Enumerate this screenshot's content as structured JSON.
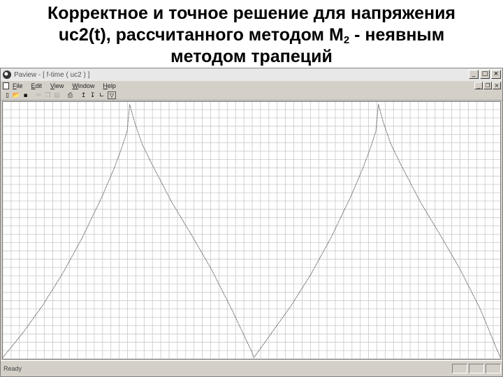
{
  "slide": {
    "title_line1": "Корректное и точное решение для напряжения",
    "title_line2_prefix": "uc2(t), рассчитанного методом M",
    "title_line2_sub": "2",
    "title_line2_suffix": " - неявным",
    "title_line3": "методом трапеций"
  },
  "window": {
    "title": "Paview - [ f-time ( uc2 ) ]",
    "minimize_label": "_",
    "maximize_label": "□",
    "close_label": "×"
  },
  "menu": {
    "items": [
      {
        "label": "File"
      },
      {
        "label": "Edit"
      },
      {
        "label": "View"
      },
      {
        "label": "Window"
      },
      {
        "label": "Help"
      }
    ],
    "mdi_minimize": "_",
    "mdi_restore": "❐",
    "mdi_close": "×"
  },
  "toolbar": {
    "new_glyph": "▯",
    "open_glyph": "📂",
    "save_glyph": "▪",
    "cut_glyph": "✂",
    "copy_glyph": "❐",
    "paste_glyph": "▤",
    "print_glyph": "⎙",
    "zoom_in_glyph": "↥",
    "zoom_out_glyph": "↧",
    "axes_glyph": "∟",
    "extra_glyph": "▽"
  },
  "status": {
    "text": "Ready"
  },
  "chart_data": {
    "type": "line",
    "grid": true,
    "xlim": [
      0,
      1
    ],
    "ylim": [
      0,
      1
    ],
    "series": [
      {
        "color": "#555555",
        "x": [
          0.0,
          0.04,
          0.08,
          0.12,
          0.16,
          0.2,
          0.225,
          0.24,
          0.25,
          0.255,
          0.265,
          0.28,
          0.3,
          0.34,
          0.38,
          0.42,
          0.46,
          0.5,
          0.505,
          0.54,
          0.58,
          0.62,
          0.66,
          0.7,
          0.725,
          0.74,
          0.75,
          0.755,
          0.765,
          0.78,
          0.8,
          0.84,
          0.88,
          0.92,
          0.96,
          1.0
        ],
        "y": [
          0.0,
          0.096,
          0.205,
          0.329,
          0.472,
          0.635,
          0.75,
          0.83,
          0.89,
          0.996,
          0.925,
          0.84,
          0.76,
          0.61,
          0.48,
          0.345,
          0.19,
          0.025,
          0.0,
          0.096,
          0.205,
          0.329,
          0.472,
          0.635,
          0.75,
          0.83,
          0.89,
          0.996,
          0.925,
          0.84,
          0.76,
          0.61,
          0.48,
          0.345,
          0.19,
          0.0
        ]
      }
    ]
  }
}
